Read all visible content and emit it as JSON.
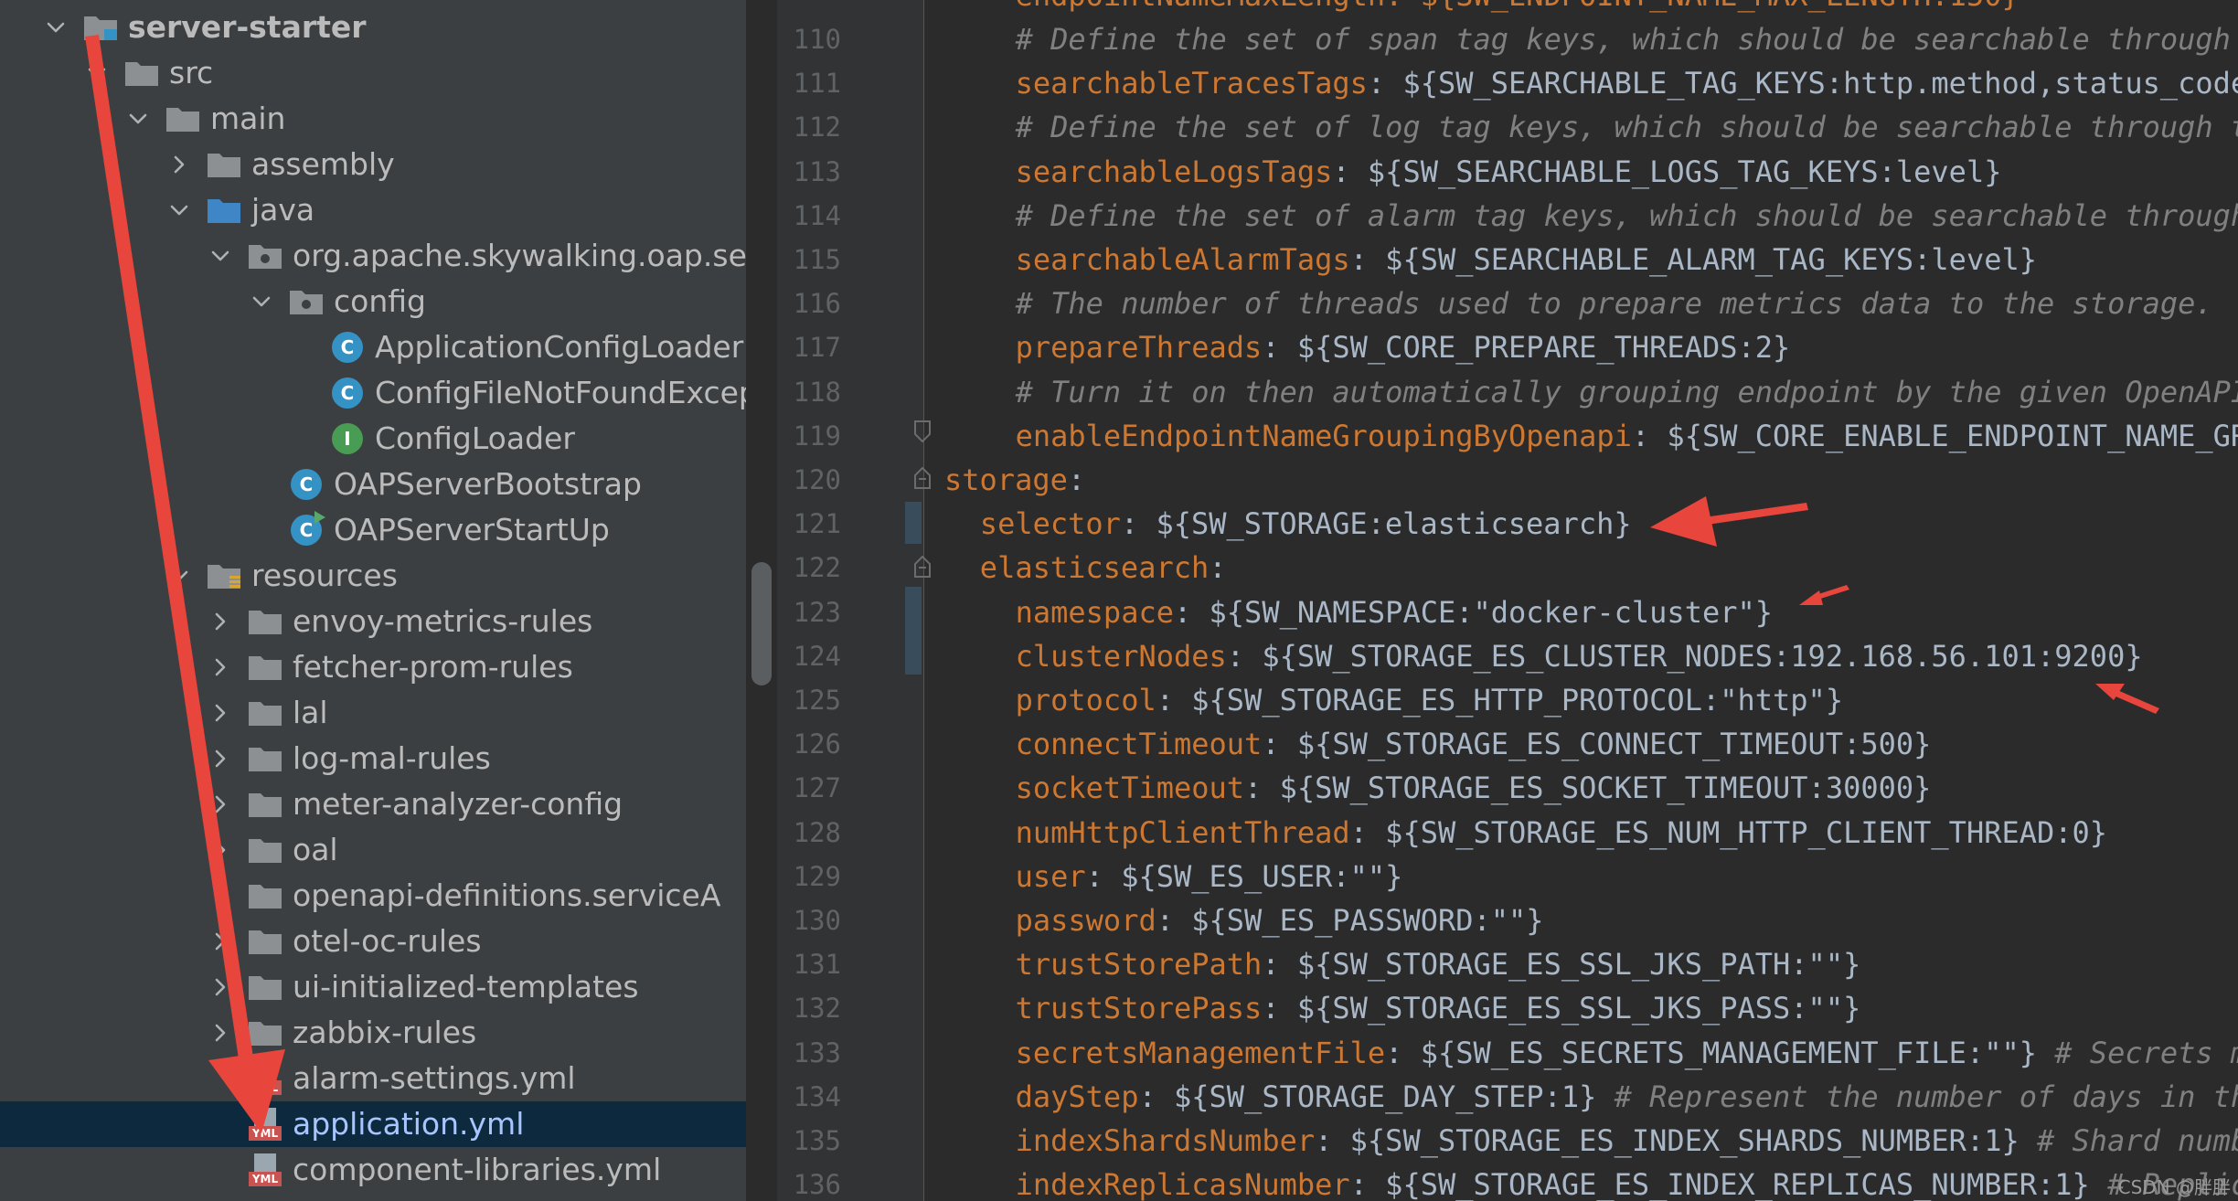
{
  "colors": {
    "tree_bg": "#3c3f41",
    "editor_bg": "#2b2b2b",
    "selection": "#0d293e",
    "key": "#cc7832",
    "comment": "#808080",
    "value": "#a9b7c6",
    "annotation_arrow": "#e8453c"
  },
  "tree": {
    "items": [
      {
        "label": "server-starter",
        "depth": 1,
        "chevron": "down",
        "icon": "module-folder-icon",
        "bold": true
      },
      {
        "label": "src",
        "depth": 2,
        "chevron": "down",
        "icon": "folder-icon"
      },
      {
        "label": "main",
        "depth": 3,
        "chevron": "down",
        "icon": "folder-icon"
      },
      {
        "label": "assembly",
        "depth": 4,
        "chevron": "right",
        "icon": "folder-icon"
      },
      {
        "label": "java",
        "depth": 4,
        "chevron": "down",
        "icon": "source-folder-icon"
      },
      {
        "label": "org.apache.skywalking.oap.server",
        "depth": 5,
        "chevron": "down",
        "icon": "package-icon"
      },
      {
        "label": "config",
        "depth": 6,
        "chevron": "down",
        "icon": "package-icon"
      },
      {
        "label": "ApplicationConfigLoader",
        "depth": 7,
        "chevron": "none",
        "icon": "class-icon"
      },
      {
        "label": "ConfigFileNotFoundException",
        "depth": 7,
        "chevron": "none",
        "icon": "class-icon"
      },
      {
        "label": "ConfigLoader",
        "depth": 7,
        "chevron": "none",
        "icon": "interface-icon"
      },
      {
        "label": "OAPServerBootstrap",
        "depth": 6,
        "chevron": "none",
        "icon": "class-icon"
      },
      {
        "label": "OAPServerStartUp",
        "depth": 6,
        "chevron": "none",
        "icon": "runnable-class-icon"
      },
      {
        "label": "resources",
        "depth": 4,
        "chevron": "down",
        "icon": "resources-folder-icon"
      },
      {
        "label": "envoy-metrics-rules",
        "depth": 5,
        "chevron": "right",
        "icon": "folder-icon"
      },
      {
        "label": "fetcher-prom-rules",
        "depth": 5,
        "chevron": "right",
        "icon": "folder-icon"
      },
      {
        "label": "lal",
        "depth": 5,
        "chevron": "right",
        "icon": "folder-icon"
      },
      {
        "label": "log-mal-rules",
        "depth": 5,
        "chevron": "right",
        "icon": "folder-icon"
      },
      {
        "label": "meter-analyzer-config",
        "depth": 5,
        "chevron": "right",
        "icon": "folder-icon"
      },
      {
        "label": "oal",
        "depth": 5,
        "chevron": "right",
        "icon": "folder-icon"
      },
      {
        "label": "openapi-definitions.serviceA",
        "depth": 5,
        "chevron": "right",
        "icon": "folder-icon"
      },
      {
        "label": "otel-oc-rules",
        "depth": 5,
        "chevron": "right",
        "icon": "folder-icon"
      },
      {
        "label": "ui-initialized-templates",
        "depth": 5,
        "chevron": "right",
        "icon": "folder-icon"
      },
      {
        "label": "zabbix-rules",
        "depth": 5,
        "chevron": "right",
        "icon": "folder-icon"
      },
      {
        "label": "alarm-settings.yml",
        "depth": 5,
        "chevron": "none",
        "icon": "yml-file-icon"
      },
      {
        "label": "application.yml",
        "depth": 5,
        "chevron": "none",
        "icon": "yml-file-icon",
        "selected": true
      },
      {
        "label": "component-libraries.yml",
        "depth": 5,
        "chevron": "none",
        "icon": "yml-file-icon"
      }
    ]
  },
  "editor": {
    "partial_top_line": "endpointNameMaxLength: ${SW_ENDPOINT_NAME_MAX_LENGTH:150}",
    "lines": [
      {
        "n": "110",
        "indent": 4,
        "comment": "# Define the set of span tag keys, which should be searchable through the GraphQL."
      },
      {
        "n": "111",
        "indent": 4,
        "key": "searchableTracesTags",
        "value": ": ${SW_SEARCHABLE_TAG_KEYS:http.method,status_code,db.type,db.instance,mq.queue,mq.topic,mq.broker}"
      },
      {
        "n": "112",
        "indent": 4,
        "comment": "# Define the set of log tag keys, which should be searchable through the GraphQL."
      },
      {
        "n": "113",
        "indent": 4,
        "key": "searchableLogsTags",
        "value": ": ${SW_SEARCHABLE_LOGS_TAG_KEYS:level}"
      },
      {
        "n": "114",
        "indent": 4,
        "comment": "# Define the set of alarm tag keys, which should be searchable through the GraphQL."
      },
      {
        "n": "115",
        "indent": 4,
        "key": "searchableAlarmTags",
        "value": ": ${SW_SEARCHABLE_ALARM_TAG_KEYS:level}"
      },
      {
        "n": "116",
        "indent": 4,
        "comment": "# The number of threads used to prepare metrics data to the storage."
      },
      {
        "n": "117",
        "indent": 4,
        "key": "prepareThreads",
        "value": ": ${SW_CORE_PREPARE_THREADS:2}"
      },
      {
        "n": "118",
        "indent": 4,
        "comment": "# Turn it on then automatically grouping endpoint by the given OpenAPI definitions."
      },
      {
        "n": "119",
        "indent": 4,
        "key": "enableEndpointNameGroupingByOpenapi",
        "value": ": ${SW_CORE_ENABLE_ENDPOINT_NAME_GROUPING_BY_OPENAPI:true}"
      },
      {
        "n": "120",
        "indent": 0,
        "key": "storage",
        "value": ":"
      },
      {
        "n": "121",
        "indent": 2,
        "key": "selector",
        "value": ": ${SW_STORAGE:elasticsearch}"
      },
      {
        "n": "122",
        "indent": 2,
        "key": "elasticsearch",
        "value": ":"
      },
      {
        "n": "123",
        "indent": 4,
        "key": "namespace",
        "value": ": ${SW_NAMESPACE:\"docker-cluster\"}"
      },
      {
        "n": "124",
        "indent": 4,
        "key": "clusterNodes",
        "value": ": ${SW_STORAGE_ES_CLUSTER_NODES:192.168.56.101:9200}"
      },
      {
        "n": "125",
        "indent": 4,
        "key": "protocol",
        "value": ": ${SW_STORAGE_ES_HTTP_PROTOCOL:\"http\"}"
      },
      {
        "n": "126",
        "indent": 4,
        "key": "connectTimeout",
        "value": ": ${SW_STORAGE_ES_CONNECT_TIMEOUT:500}"
      },
      {
        "n": "127",
        "indent": 4,
        "key": "socketTimeout",
        "value": ": ${SW_STORAGE_ES_SOCKET_TIMEOUT:30000}"
      },
      {
        "n": "128",
        "indent": 4,
        "key": "numHttpClientThread",
        "value": ": ${SW_STORAGE_ES_NUM_HTTP_CLIENT_THREAD:0}"
      },
      {
        "n": "129",
        "indent": 4,
        "key": "user",
        "value": ": ${SW_ES_USER:\"\"}"
      },
      {
        "n": "130",
        "indent": 4,
        "key": "password",
        "value": ": ${SW_ES_PASSWORD:\"\"}"
      },
      {
        "n": "131",
        "indent": 4,
        "key": "trustStorePath",
        "value": ": ${SW_STORAGE_ES_SSL_JKS_PATH:\"\"}"
      },
      {
        "n": "132",
        "indent": 4,
        "key": "trustStorePass",
        "value": ": ${SW_STORAGE_ES_SSL_JKS_PASS:\"\"}"
      },
      {
        "n": "133",
        "indent": 4,
        "key": "secretsManagementFile",
        "value": ": ${SW_ES_SECRETS_MANAGEMENT_FILE:\"\"} ",
        "comment": "# Secrets management file in the properties format includes the username, password"
      },
      {
        "n": "134",
        "indent": 4,
        "key": "dayStep",
        "value": ": ${SW_STORAGE_DAY_STEP:1} ",
        "comment": "# Represent the number of days in the one minute/hour/day index."
      },
      {
        "n": "135",
        "indent": 4,
        "key": "indexShardsNumber",
        "value": ": ${SW_STORAGE_ES_INDEX_SHARDS_NUMBER:1} ",
        "comment": "# Shard number of new indexes"
      },
      {
        "n": "136",
        "indent": 4,
        "key": "indexReplicasNumber",
        "value": ": ${SW_STORAGE_ES_INDEX_REPLICAS_NUMBER:1} ",
        "comment": "# Replicas number of new indexes"
      }
    ]
  },
  "watermark": "CSDN @胖胖"
}
